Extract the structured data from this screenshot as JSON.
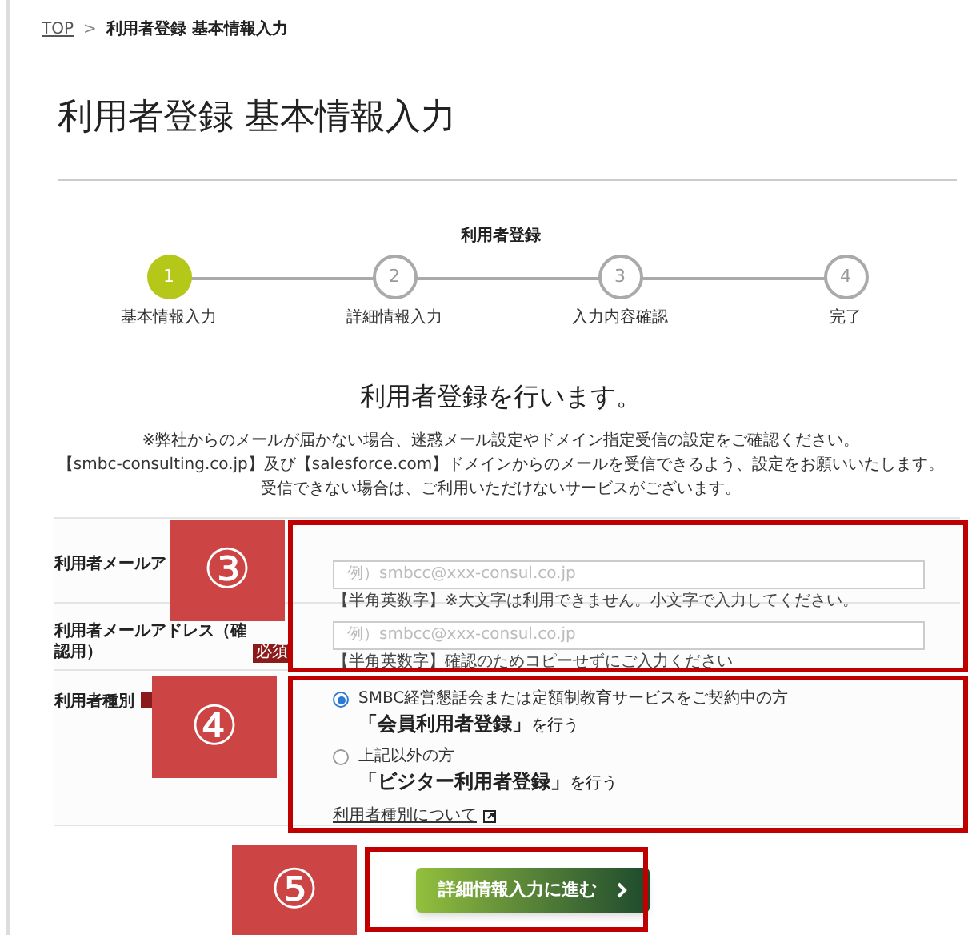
{
  "breadcrumb": [
    {
      "kind": "link",
      "label": "TOP"
    },
    {
      "kind": "separator",
      "label": ">"
    },
    {
      "kind": "current",
      "label": "利用者登録 基本情報入力"
    }
  ],
  "title": "利用者登録 基本情報入力",
  "stepper": {
    "title": "利用者登録",
    "steps": [
      {
        "number": "1",
        "label": "基本情報入力",
        "selected": true
      },
      {
        "number": "2",
        "label": "詳細情報入力",
        "selected": false
      },
      {
        "number": "3",
        "label": "入力内容確認",
        "selected": false
      },
      {
        "number": "4",
        "label": "完了",
        "selected": false
      }
    ]
  },
  "heading": "利用者登録を行います。",
  "notes": [
    "※弊社からのメールが届かない場合、迷惑メール設定やドメイン指定受信の設定をご確認ください。",
    "【smbc-consulting.co.jp】及び【salesforce.com】ドメインからのメールを受信できるよう、設定をお願いいたします。",
    "受信できない場合は、ご利用いただけないサービスがございます。"
  ],
  "form": {
    "rows": [
      {
        "kind": "email",
        "label": "利用者メールア",
        "placeholder": "例）smbcc@xxx-consul.co.jp",
        "hint": "【半角英数字】※大文字は利用できません。小文字で入力してください。"
      },
      {
        "kind": "email",
        "label": "利用者メールアドレス（確認用）",
        "badge": "必須",
        "placeholder": "例）smbcc@xxx-consul.co.jp",
        "hint": "【半角英数字】確認のためコピーせずにご入力ください"
      },
      {
        "kind": "radio",
        "label": "利用者種別",
        "required": true,
        "options": [
          {
            "caption": "SMBC経営懇話会または定額制教育サービスをご契約中の方",
            "action": "**「会員利用者登録」**を行う",
            "selected": true
          },
          {
            "caption": "上記以外の方",
            "action": "**「ビジター利用者登録」**を行う",
            "selected": false
          }
        ],
        "link": "利用者種別について"
      }
    ]
  },
  "button": "詳細情報入力に進む",
  "annotations": [
    {
      "label": "③"
    },
    {
      "label": "④"
    },
    {
      "label": "⑤"
    }
  ]
}
